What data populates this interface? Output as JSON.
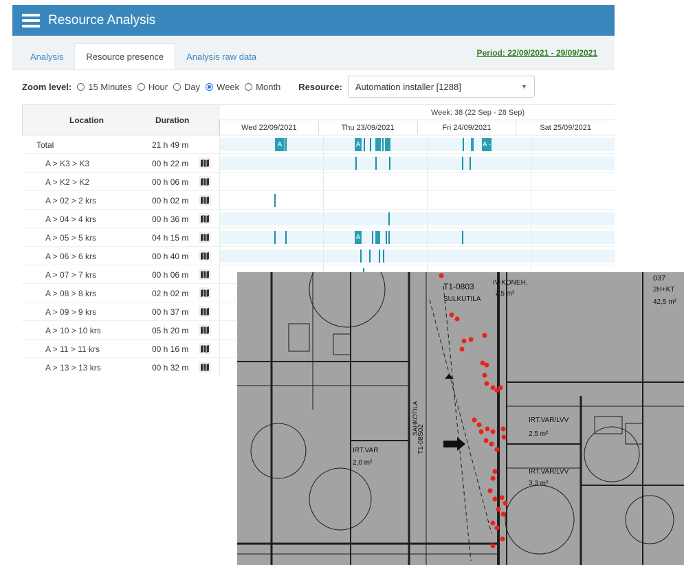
{
  "header": {
    "title": "Resource Analysis"
  },
  "tabs": [
    {
      "label": "Analysis"
    },
    {
      "label": "Resource presence"
    },
    {
      "label": "Analysis raw data"
    }
  ],
  "period": "Period: 22/09/2021 - 29/09/2021",
  "toolbar": {
    "zoom_label": "Zoom level:",
    "zoom_options": [
      "15 Minutes",
      "Hour",
      "Day",
      "Week",
      "Month"
    ],
    "zoom_selected": "Week",
    "resource_label": "Resource:",
    "resource_value": "Automation installer [1288]"
  },
  "table": {
    "headers": {
      "location": "Location",
      "duration": "Duration"
    },
    "week_label": "Week: 38 (22 Sep - 28 Sep)",
    "days": [
      "Wed 22/09/2021",
      "Thu 23/09/2021",
      "Fri 24/09/2021",
      "Sat 25/09/2021"
    ],
    "rows": [
      {
        "location": "Total",
        "duration": "21 h 49 m"
      },
      {
        "location": "A > K3 > K3",
        "duration": "00 h 22 m"
      },
      {
        "location": "A > K2 > K2",
        "duration": "00 h 06 m"
      },
      {
        "location": "A > 02 > 2 krs",
        "duration": "00 h 02 m"
      },
      {
        "location": "A > 04 > 4 krs",
        "duration": "00 h 36 m"
      },
      {
        "location": "A > 05 > 5 krs",
        "duration": "04 h 15 m"
      },
      {
        "location": "A > 06 > 6 krs",
        "duration": "00 h 40 m"
      },
      {
        "location": "A > 07 > 7 krs",
        "duration": "00 h 06 m"
      },
      {
        "location": "A > 08 > 8 krs",
        "duration": "02 h 02 m"
      },
      {
        "location": "A > 09 > 9 krs",
        "duration": "00 h 37 m"
      },
      {
        "location": "A > 10 > 10 krs",
        "duration": "05 h 20 m"
      },
      {
        "location": "A > 11 > 11 krs",
        "duration": "00 h 16 m"
      },
      {
        "location": "A > 13 > 13 krs",
        "duration": "00 h 32 m"
      }
    ],
    "segment_labels": {
      "a": "A",
      "a_short": "A -"
    }
  },
  "floorplan": {
    "rooms": [
      "T1-0803",
      "SULKUTILA",
      "IV-KONEH.",
      "7,5 m²",
      "037",
      "2H+KT",
      "42,5 m²",
      "IRT.VAR/LVV",
      "2,5 m²",
      "IRT.VAR",
      "2,0 m²",
      "IRT.VAR/LVV",
      "3,3 m²",
      "SAHKOTILA",
      "T1-08S02"
    ],
    "marker_color": "#e8231b"
  }
}
